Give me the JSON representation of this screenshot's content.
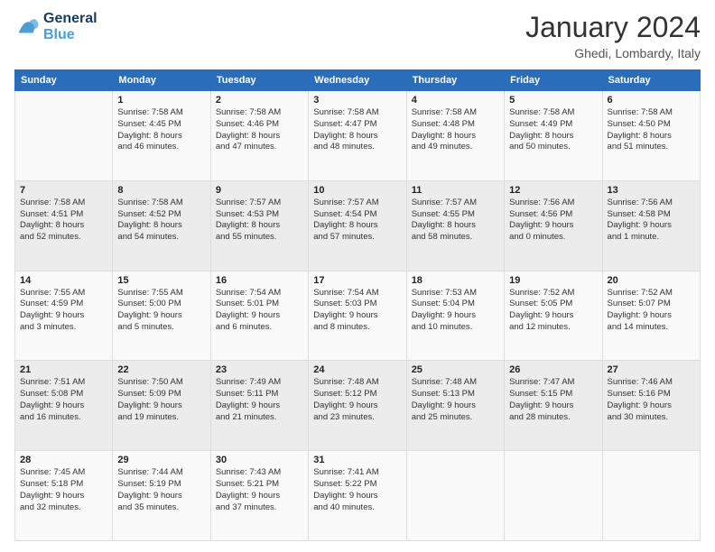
{
  "logo": {
    "line1": "General",
    "line2": "Blue"
  },
  "title": "January 2024",
  "location": "Ghedi, Lombardy, Italy",
  "weekdays": [
    "Sunday",
    "Monday",
    "Tuesday",
    "Wednesday",
    "Thursday",
    "Friday",
    "Saturday"
  ],
  "weeks": [
    [
      {
        "day": "",
        "info": ""
      },
      {
        "day": "1",
        "info": "Sunrise: 7:58 AM\nSunset: 4:45 PM\nDaylight: 8 hours\nand 46 minutes."
      },
      {
        "day": "2",
        "info": "Sunrise: 7:58 AM\nSunset: 4:46 PM\nDaylight: 8 hours\nand 47 minutes."
      },
      {
        "day": "3",
        "info": "Sunrise: 7:58 AM\nSunset: 4:47 PM\nDaylight: 8 hours\nand 48 minutes."
      },
      {
        "day": "4",
        "info": "Sunrise: 7:58 AM\nSunset: 4:48 PM\nDaylight: 8 hours\nand 49 minutes."
      },
      {
        "day": "5",
        "info": "Sunrise: 7:58 AM\nSunset: 4:49 PM\nDaylight: 8 hours\nand 50 minutes."
      },
      {
        "day": "6",
        "info": "Sunrise: 7:58 AM\nSunset: 4:50 PM\nDaylight: 8 hours\nand 51 minutes."
      }
    ],
    [
      {
        "day": "7",
        "info": "Sunrise: 7:58 AM\nSunset: 4:51 PM\nDaylight: 8 hours\nand 52 minutes."
      },
      {
        "day": "8",
        "info": "Sunrise: 7:58 AM\nSunset: 4:52 PM\nDaylight: 8 hours\nand 54 minutes."
      },
      {
        "day": "9",
        "info": "Sunrise: 7:57 AM\nSunset: 4:53 PM\nDaylight: 8 hours\nand 55 minutes."
      },
      {
        "day": "10",
        "info": "Sunrise: 7:57 AM\nSunset: 4:54 PM\nDaylight: 8 hours\nand 57 minutes."
      },
      {
        "day": "11",
        "info": "Sunrise: 7:57 AM\nSunset: 4:55 PM\nDaylight: 8 hours\nand 58 minutes."
      },
      {
        "day": "12",
        "info": "Sunrise: 7:56 AM\nSunset: 4:56 PM\nDaylight: 9 hours\nand 0 minutes."
      },
      {
        "day": "13",
        "info": "Sunrise: 7:56 AM\nSunset: 4:58 PM\nDaylight: 9 hours\nand 1 minute."
      }
    ],
    [
      {
        "day": "14",
        "info": "Sunrise: 7:55 AM\nSunset: 4:59 PM\nDaylight: 9 hours\nand 3 minutes."
      },
      {
        "day": "15",
        "info": "Sunrise: 7:55 AM\nSunset: 5:00 PM\nDaylight: 9 hours\nand 5 minutes."
      },
      {
        "day": "16",
        "info": "Sunrise: 7:54 AM\nSunset: 5:01 PM\nDaylight: 9 hours\nand 6 minutes."
      },
      {
        "day": "17",
        "info": "Sunrise: 7:54 AM\nSunset: 5:03 PM\nDaylight: 9 hours\nand 8 minutes."
      },
      {
        "day": "18",
        "info": "Sunrise: 7:53 AM\nSunset: 5:04 PM\nDaylight: 9 hours\nand 10 minutes."
      },
      {
        "day": "19",
        "info": "Sunrise: 7:52 AM\nSunset: 5:05 PM\nDaylight: 9 hours\nand 12 minutes."
      },
      {
        "day": "20",
        "info": "Sunrise: 7:52 AM\nSunset: 5:07 PM\nDaylight: 9 hours\nand 14 minutes."
      }
    ],
    [
      {
        "day": "21",
        "info": "Sunrise: 7:51 AM\nSunset: 5:08 PM\nDaylight: 9 hours\nand 16 minutes."
      },
      {
        "day": "22",
        "info": "Sunrise: 7:50 AM\nSunset: 5:09 PM\nDaylight: 9 hours\nand 19 minutes."
      },
      {
        "day": "23",
        "info": "Sunrise: 7:49 AM\nSunset: 5:11 PM\nDaylight: 9 hours\nand 21 minutes."
      },
      {
        "day": "24",
        "info": "Sunrise: 7:48 AM\nSunset: 5:12 PM\nDaylight: 9 hours\nand 23 minutes."
      },
      {
        "day": "25",
        "info": "Sunrise: 7:48 AM\nSunset: 5:13 PM\nDaylight: 9 hours\nand 25 minutes."
      },
      {
        "day": "26",
        "info": "Sunrise: 7:47 AM\nSunset: 5:15 PM\nDaylight: 9 hours\nand 28 minutes."
      },
      {
        "day": "27",
        "info": "Sunrise: 7:46 AM\nSunset: 5:16 PM\nDaylight: 9 hours\nand 30 minutes."
      }
    ],
    [
      {
        "day": "28",
        "info": "Sunrise: 7:45 AM\nSunset: 5:18 PM\nDaylight: 9 hours\nand 32 minutes."
      },
      {
        "day": "29",
        "info": "Sunrise: 7:44 AM\nSunset: 5:19 PM\nDaylight: 9 hours\nand 35 minutes."
      },
      {
        "day": "30",
        "info": "Sunrise: 7:43 AM\nSunset: 5:21 PM\nDaylight: 9 hours\nand 37 minutes."
      },
      {
        "day": "31",
        "info": "Sunrise: 7:41 AM\nSunset: 5:22 PM\nDaylight: 9 hours\nand 40 minutes."
      },
      {
        "day": "",
        "info": ""
      },
      {
        "day": "",
        "info": ""
      },
      {
        "day": "",
        "info": ""
      }
    ]
  ]
}
